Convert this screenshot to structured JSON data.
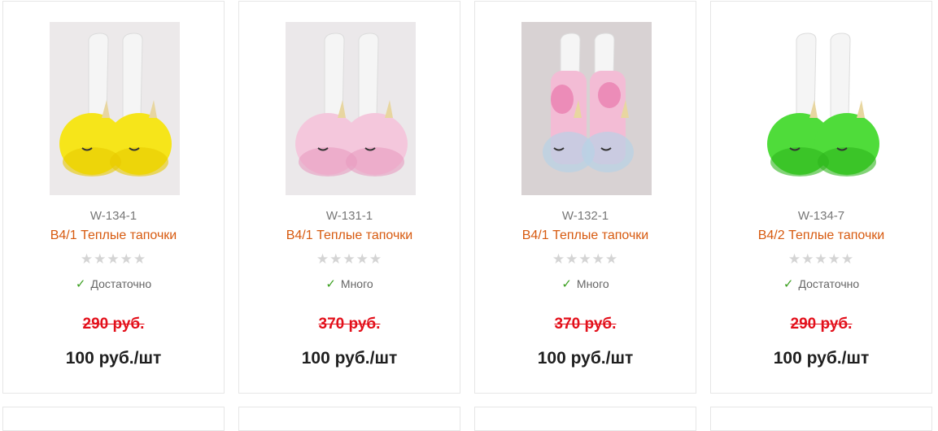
{
  "products": [
    {
      "sku": "W-134-1",
      "name": "В4/1 Теплые тапочки",
      "rating_stars": "★★★★★",
      "rating_value": 0,
      "stock": "Достаточно",
      "old_price": "290 руб.",
      "price": "100 руб./шт",
      "slipper_color": "#f6e51a",
      "slipper_shade": "#e7c900",
      "photo_bg": "#ece9ea"
    },
    {
      "sku": "W-131-1",
      "name": "В4/1 Теплые тапочки",
      "rating_stars": "★★★★★",
      "rating_value": 0,
      "stock": "Много",
      "old_price": "370 руб.",
      "price": "100 руб./шт",
      "slipper_color": "#f4c7dc",
      "slipper_shade": "#e79bbf",
      "photo_bg": "#ebe8ea"
    },
    {
      "sku": "W-132-1",
      "name": "В4/1 Теплые тапочки",
      "rating_stars": "★★★★★",
      "rating_value": 0,
      "stock": "Много",
      "old_price": "370 руб.",
      "price": "100 руб./шт",
      "slipper_color": "#f3bcd5",
      "slipper_shade": "#b8d2e6",
      "photo_bg": "#d8d2d3"
    },
    {
      "sku": "W-134-7",
      "name": "В4/2 Теплые тапочки",
      "rating_stars": "★★★★★",
      "rating_value": 0,
      "stock": "Достаточно",
      "old_price": "290 руб.",
      "price": "100 руб./шт",
      "slipper_color": "#4fdc3a",
      "slipper_shade": "#2fb51c",
      "photo_bg": "#ffffff"
    }
  ],
  "colors": {
    "name_link": "#d75a0f",
    "old_price": "#e3101b",
    "in_stock_check": "#3a9f1e"
  }
}
